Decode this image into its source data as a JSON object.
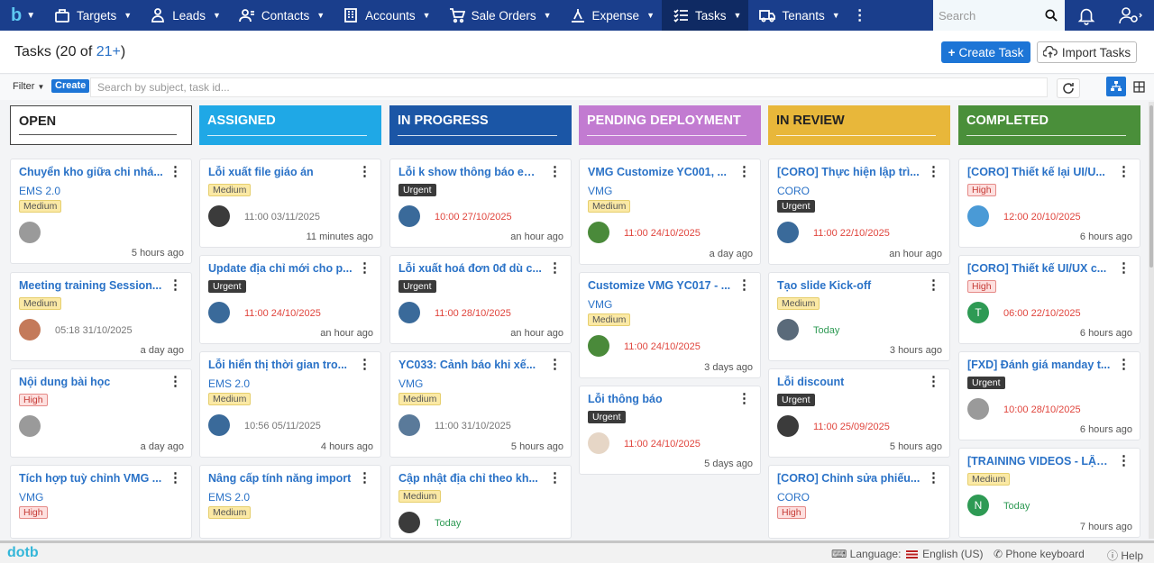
{
  "nav": {
    "items": [
      {
        "label": "Targets",
        "icon": "briefcase-icon"
      },
      {
        "label": "Leads",
        "icon": "user-icon"
      },
      {
        "label": "Contacts",
        "icon": "contacts-icon"
      },
      {
        "label": "Accounts",
        "icon": "building-icon"
      },
      {
        "label": "Sale Orders",
        "icon": "cart-icon"
      },
      {
        "label": "Expense",
        "icon": "expense-icon"
      },
      {
        "label": "Tasks",
        "icon": "tasks-icon"
      },
      {
        "label": "Tenants",
        "icon": "truck-icon"
      }
    ],
    "search_placeholder": "Search",
    "active": "Tasks"
  },
  "header": {
    "title_prefix": "Tasks (20 of ",
    "title_count": "21+",
    "title_suffix": ")",
    "create_task": "Create Task",
    "import_tasks": "Import Tasks"
  },
  "filterbar": {
    "filter_label": "Filter",
    "create_label": "Create",
    "search_placeholder": "Search by subject, task id..."
  },
  "columns": [
    {
      "title": "OPEN",
      "color": "#ffffff",
      "text_color": "#222222",
      "cards": [
        {
          "subject": "Chuyển kho giữa chi nhá...",
          "account": "EMS 2.0",
          "priority": "Medium",
          "due": "",
          "ago": "5 hours ago",
          "avatar": "#9a9a9a"
        },
        {
          "subject": "Meeting training Session...",
          "account": "",
          "priority": "Medium",
          "due": "05:18 31/10/2025",
          "due_style": "gray",
          "ago": "a day ago",
          "avatar": "#c47a5a"
        },
        {
          "subject": "Nội dung bài học",
          "account": "",
          "priority": "High",
          "due": "",
          "ago": "a day ago",
          "avatar": "#9a9a9a"
        },
        {
          "subject": "Tích hợp tuỳ chỉnh VMG ...",
          "account": "VMG",
          "priority": "High",
          "due": "",
          "ago": "",
          "avatar": ""
        }
      ]
    },
    {
      "title": "ASSIGNED",
      "color": "#1fa8e6",
      "text_color": "#ffffff",
      "cards": [
        {
          "subject": "Lỗi xuất file giáo án",
          "account": "",
          "priority": "Medium",
          "due": "11:00 03/11/2025",
          "due_style": "gray",
          "ago": "11 minutes ago",
          "avatar": "#3b3b3b"
        },
        {
          "subject": "Update địa chỉ mới cho p...",
          "account": "",
          "priority": "Urgent",
          "due": "11:00 24/10/2025",
          "due_style": "red",
          "ago": "an hour ago",
          "avatar": "#3a6a9a"
        },
        {
          "subject": "Lỗi hiển thị thời gian tro...",
          "account": "EMS 2.0",
          "priority": "Medium",
          "due": "10:56 05/11/2025",
          "due_style": "gray",
          "ago": "4 hours ago",
          "avatar": "#3a6a9a"
        },
        {
          "subject": "Nâng cấp tính năng import",
          "account": "EMS 2.0",
          "priority": "Medium",
          "due": "",
          "ago": "",
          "avatar": ""
        }
      ]
    },
    {
      "title": "IN PROGRESS",
      "color": "#1b56a6",
      "text_color": "#ffffff",
      "cards": [
        {
          "subject": "Lỗi k show thông báo em...",
          "account": "",
          "priority": "Urgent",
          "due": "10:00 27/10/2025",
          "due_style": "red",
          "ago": "an hour ago",
          "avatar": "#3a6a9a"
        },
        {
          "subject": "Lỗi xuất hoá đơn 0đ dù c...",
          "account": "",
          "priority": "Urgent",
          "due": "11:00 28/10/2025",
          "due_style": "red",
          "ago": "an hour ago",
          "avatar": "#3a6a9a"
        },
        {
          "subject": "YC033: Cảnh báo khi xế...",
          "account": "VMG",
          "priority": "Medium",
          "due": "11:00 31/10/2025",
          "due_style": "gray",
          "ago": "5 hours ago",
          "avatar": "#5a7a9a"
        },
        {
          "subject": "Cập nhật địa chỉ theo kh...",
          "account": "",
          "priority": "Medium",
          "due": "Today",
          "due_style": "green",
          "ago": "",
          "avatar": "#3b3b3b"
        }
      ]
    },
    {
      "title": "PENDING DEPLOYMENT",
      "color": "#c27bd1",
      "text_color": "#ffffff",
      "cards": [
        {
          "subject": "VMG Customize YC001, ...",
          "account": "VMG",
          "priority": "Medium",
          "due": "11:00 24/10/2025",
          "due_style": "red",
          "ago": "a day ago",
          "avatar": "#4a8a3a"
        },
        {
          "subject": "Customize VMG YC017 - ...",
          "account": "VMG",
          "priority": "Medium",
          "due": "11:00 24/10/2025",
          "due_style": "red",
          "ago": "3 days ago",
          "avatar": "#4a8a3a"
        },
        {
          "subject": "Lỗi thông báo",
          "account": "",
          "priority": "Urgent",
          "due": "11:00 24/10/2025",
          "due_style": "red",
          "ago": "5 days ago",
          "avatar": "#e6d6c6"
        }
      ]
    },
    {
      "title": "IN REVIEW",
      "color": "#e8b73a",
      "text_color": "#222222",
      "cards": [
        {
          "subject": "[CORO] Thực hiện lập trì...",
          "account": "CORO",
          "priority": "Urgent",
          "due": "11:00 22/10/2025",
          "due_style": "red",
          "ago": "an hour ago",
          "avatar": "#3a6a9a"
        },
        {
          "subject": "Tạo slide Kick-off",
          "account": "",
          "priority": "Medium",
          "due": "Today",
          "due_style": "green",
          "ago": "3 hours ago",
          "avatar": "#5a6a7a"
        },
        {
          "subject": "Lỗi discount",
          "account": "",
          "priority": "Urgent",
          "due": "11:00 25/09/2025",
          "due_style": "red",
          "ago": "5 hours ago",
          "avatar": "#3b3b3b"
        },
        {
          "subject": "[CORO] Chỉnh sửa phiếu...",
          "account": "CORO",
          "priority": "High",
          "due": "",
          "ago": "",
          "avatar": ""
        }
      ]
    },
    {
      "title": "COMPLETED",
      "color": "#4a8f3a",
      "text_color": "#ffffff",
      "cards": [
        {
          "subject": "[CORO] Thiết kế lại UI/U...",
          "account": "",
          "priority": "High",
          "due": "12:00 20/10/2025",
          "due_style": "red",
          "ago": "6 hours ago",
          "avatar": "#4a9ad6"
        },
        {
          "subject": "[CORO] Thiết kế UI/UX c...",
          "account": "",
          "priority": "High",
          "due": "06:00 22/10/2025",
          "due_style": "red",
          "ago": "6 hours ago",
          "avatar": "#2e9a54",
          "avatar_letter": "T"
        },
        {
          "subject": "[FXD] Đánh giá manday t...",
          "account": "",
          "priority": "Urgent",
          "due": "10:00 28/10/2025",
          "due_style": "red",
          "ago": "6 hours ago",
          "avatar": "#9a9a9a"
        },
        {
          "subject": "[TRAINING VIDEOS - LẬP...",
          "account": "",
          "priority": "Medium",
          "due": "Today",
          "due_style": "green",
          "ago": "7 hours ago",
          "avatar": "#2e9a54",
          "avatar_letter": "N"
        }
      ]
    }
  ],
  "footer": {
    "brand": "dotb",
    "language_label": "Language:",
    "language_value": "English (US)",
    "phone_keyboard": "Phone keyboard",
    "help": "Help"
  }
}
